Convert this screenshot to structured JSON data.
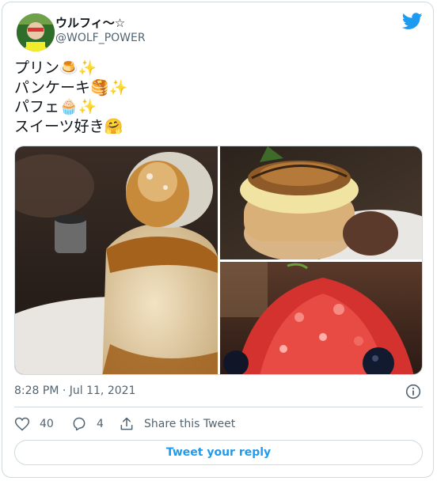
{
  "user": {
    "display_name": "ウルフィ〜☆",
    "handle": "@WOLF_POWER"
  },
  "tweet": {
    "lines": [
      "プリン🍮✨",
      "パンケーキ🥞✨",
      "パフェ🧁✨",
      "スイーツ好き🤗"
    ]
  },
  "photos": [
    {
      "name": "pudding-photo"
    },
    {
      "name": "pancake-photo"
    },
    {
      "name": "strawberry-parfait-photo"
    }
  ],
  "meta": {
    "timestamp": "8:28 PM · Jul 11, 2021"
  },
  "actions": {
    "likes": "40",
    "replies": "4",
    "share_label": "Share this Tweet"
  },
  "reply_button_label": "Tweet your reply",
  "colors": {
    "brand_blue": "#1d9bf0",
    "text": "#0f1419",
    "muted": "#536471",
    "border": "#cfd9de"
  },
  "icons": [
    "twitter-bird-icon",
    "info-icon",
    "heart-icon",
    "reply-icon",
    "share-icon"
  ]
}
